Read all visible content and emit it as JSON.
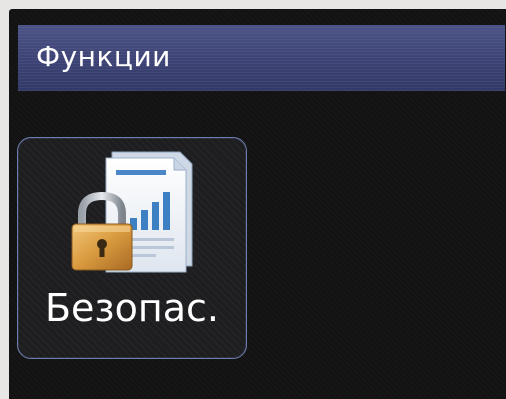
{
  "header": {
    "title": "Функции"
  },
  "tiles": [
    {
      "label": "Безопас.",
      "icon": "lock-document-icon"
    }
  ],
  "colors": {
    "title_bar": "#3c4274",
    "tile_border": "#6d7eb2",
    "background": "#141313",
    "text": "#ffffff"
  }
}
